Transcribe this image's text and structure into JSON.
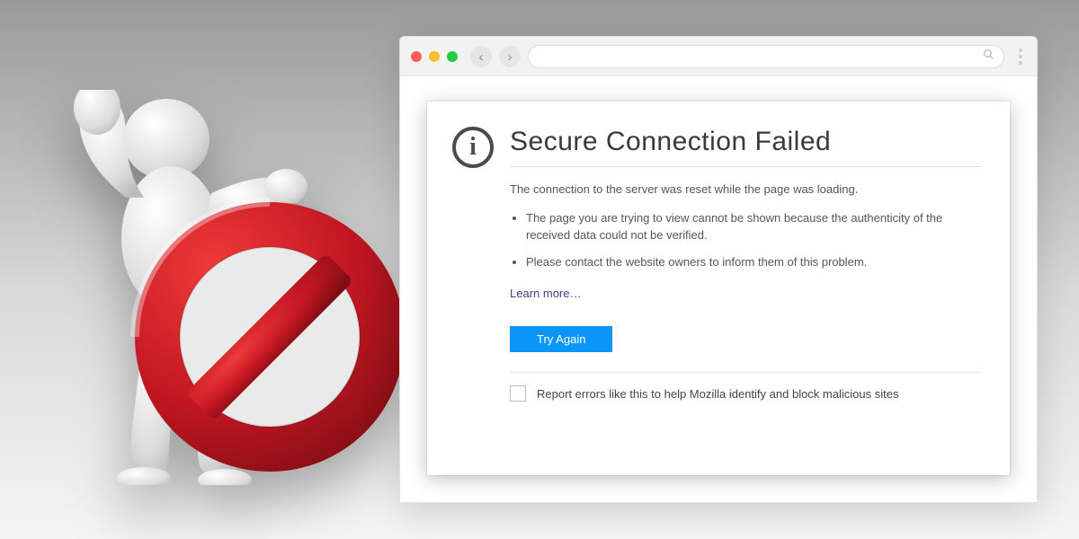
{
  "browser": {
    "back": "‹",
    "forward": "›",
    "address_value": "",
    "search_placeholder": ""
  },
  "error": {
    "info_glyph": "i",
    "title": "Secure Connection Failed",
    "lead": "The connection to the server was reset while the page was loading.",
    "bullets": [
      "The page you are trying to view cannot be shown because the authenticity of the received data could not be verified.",
      "Please contact the website owners to inform them of this problem."
    ],
    "learn_more": "Learn more…",
    "try_again": "Try Again",
    "report_label": "Report errors like this to help Mozilla identify and block malicious sites"
  },
  "illustration": {
    "figure": "stop-figure",
    "sign": "no-entry-sign"
  },
  "colors": {
    "accent": "#0996f8",
    "sign_red": "#c31722"
  }
}
